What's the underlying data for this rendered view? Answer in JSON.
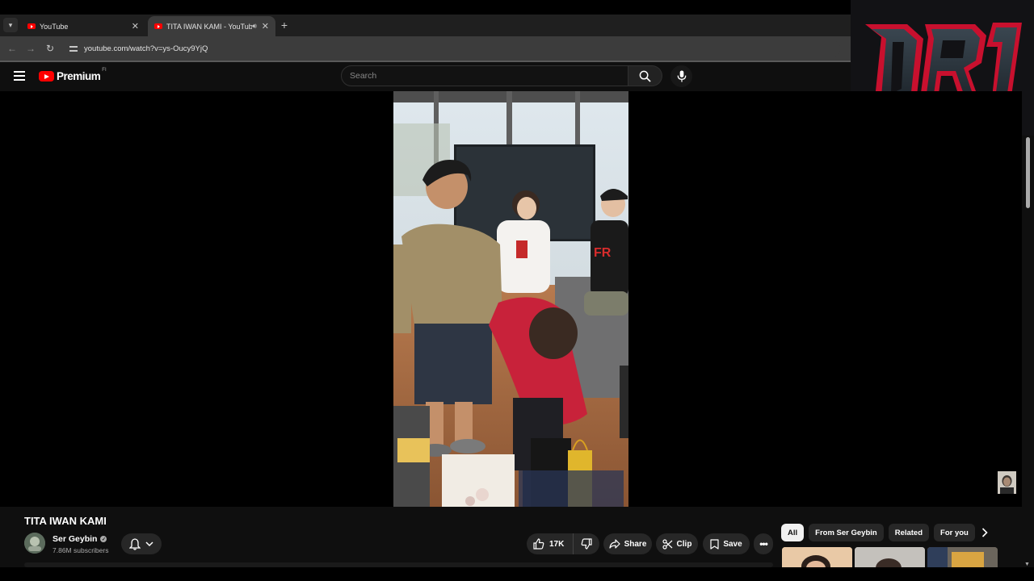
{
  "browser": {
    "tabs": [
      {
        "title": "YouTube",
        "active": false
      },
      {
        "title": "TITA IWAN KAMI - YouTube",
        "active": true
      }
    ],
    "url": "youtube.com/watch?v=ys-Oucy9YjQ"
  },
  "overlay": {
    "logo_text": "DRJ"
  },
  "masthead": {
    "brand": "Premium",
    "country_code": "FI",
    "search_placeholder": "Search"
  },
  "video": {
    "title": "TITA IWAN KAMI",
    "channel": {
      "name": "Ser Geybin",
      "verified": true,
      "subscribers": "7.86M subscribers"
    },
    "actions": {
      "likes": "17K",
      "share": "Share",
      "clip": "Clip",
      "save": "Save",
      "more": "•••"
    }
  },
  "recommendations": {
    "chips": [
      {
        "label": "All",
        "selected": true
      },
      {
        "label": "From Ser Geybin",
        "selected": false
      },
      {
        "label": "Related",
        "selected": false
      },
      {
        "label": "For you",
        "selected": false
      }
    ]
  },
  "colors": {
    "accent": "#ff0000",
    "background": "#0f0f0f",
    "chip": "#272727",
    "logo_red": "#c8102e"
  }
}
